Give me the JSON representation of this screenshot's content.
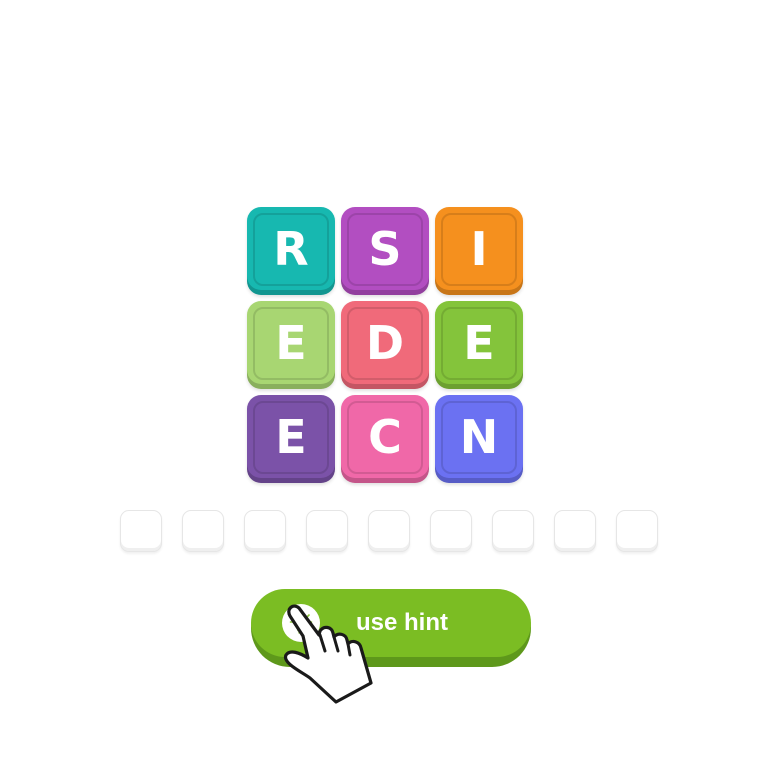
{
  "board": {
    "tiles": [
      {
        "letter": "R",
        "color": "#17b8b0"
      },
      {
        "letter": "S",
        "color": "#b24ec1"
      },
      {
        "letter": "I",
        "color": "#f5901e"
      },
      {
        "letter": "E",
        "color": "#a8d672"
      },
      {
        "letter": "D",
        "color": "#f06a7a"
      },
      {
        "letter": "E",
        "color": "#84c43b"
      },
      {
        "letter": "E",
        "color": "#7b52a8"
      },
      {
        "letter": "C",
        "color": "#f068a8"
      },
      {
        "letter": "N",
        "color": "#6b71f2"
      }
    ]
  },
  "answer": {
    "slot_count": 9
  },
  "hint_button": {
    "label": "use hint",
    "icon": "lightbulb-icon"
  },
  "cursor": {
    "icon": "pointing-hand-icon"
  }
}
